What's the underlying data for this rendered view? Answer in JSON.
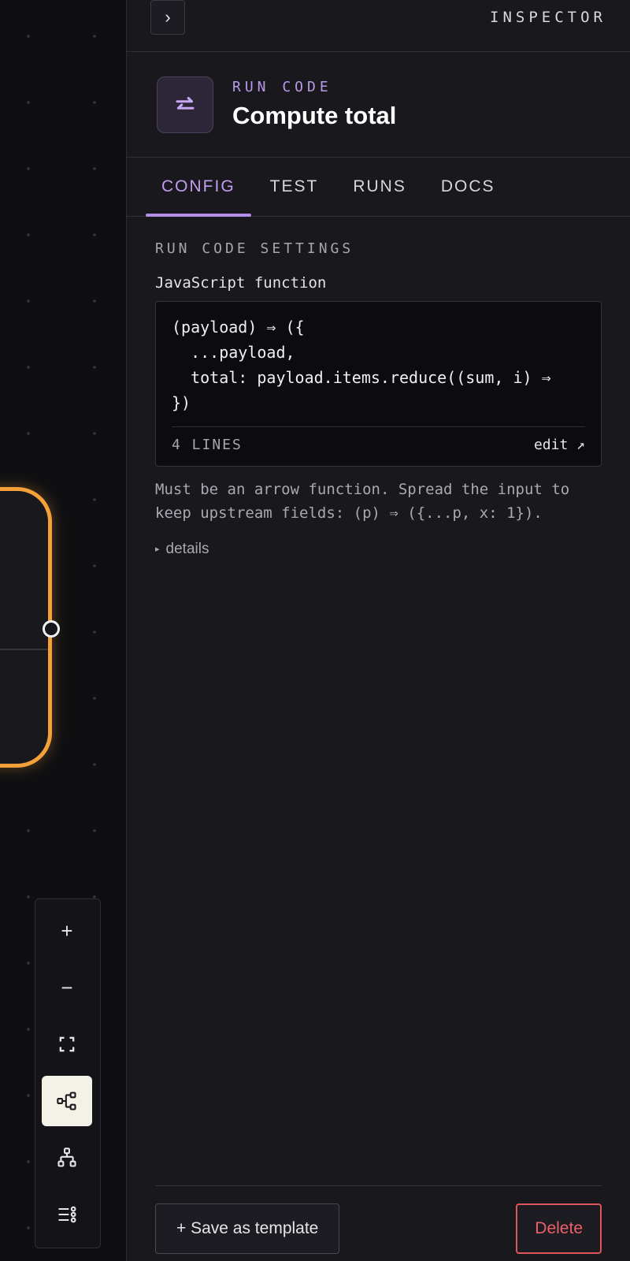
{
  "inspector": {
    "title": "INSPECTOR",
    "collapse_icon": "chevron-right-icon"
  },
  "node": {
    "kind": "RUN CODE",
    "name": "Compute total",
    "icon": "swap-arrows-icon",
    "accent": "#b99ae8"
  },
  "tabs": [
    {
      "label": "CONFIG",
      "active": true
    },
    {
      "label": "TEST",
      "active": false
    },
    {
      "label": "RUNS",
      "active": false
    },
    {
      "label": "DOCS",
      "active": false
    }
  ],
  "settings": {
    "section_label": "RUN CODE SETTINGS",
    "field_label": "JavaScript function",
    "code": "(payload) ⇒ ({\n  ...payload,\n  total: payload.items.reduce((sum, i) ⇒\n})",
    "line_count": "4 LINES",
    "edit_label": "edit ↗",
    "help": "Must be an arrow function. Spread the input to keep upstream fields: (p) ⇒ ({...p, x: 1}).",
    "details_label": "details"
  },
  "footer": {
    "save_label": "+ Save as template",
    "delete_label": "Delete"
  },
  "canvas": {
    "selected_node_color": "#f5a13a",
    "controls": [
      {
        "name": "zoom-in-icon",
        "glyph": "+"
      },
      {
        "name": "zoom-out-icon",
        "glyph": "−"
      },
      {
        "name": "fit-view-icon"
      },
      {
        "name": "layout-horizontal-icon",
        "active": true
      },
      {
        "name": "layout-vertical-icon"
      },
      {
        "name": "list-icon"
      }
    ]
  }
}
